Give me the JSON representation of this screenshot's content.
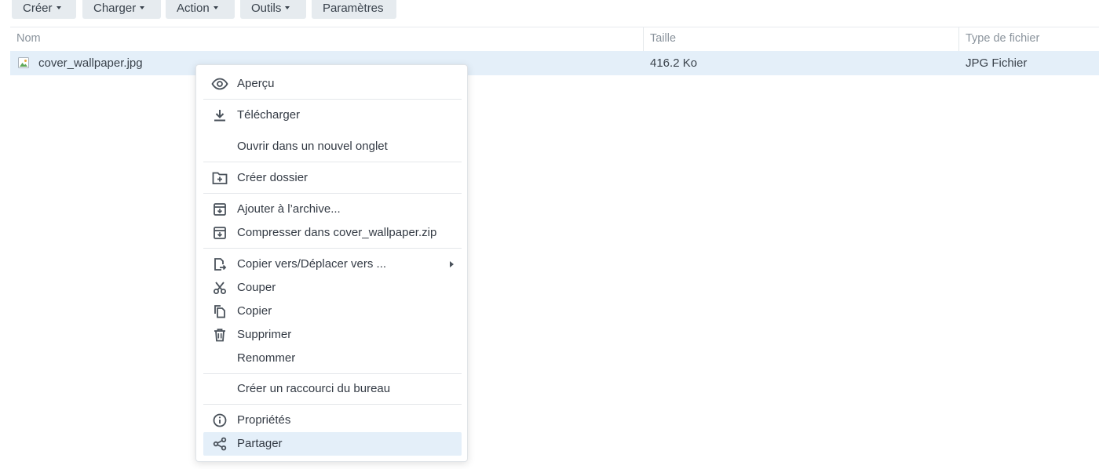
{
  "toolbar": {
    "create": "Créer",
    "upload": "Charger",
    "action": "Action",
    "tools": "Outils",
    "settings": "Paramètres"
  },
  "columns": {
    "name": "Nom",
    "size": "Taille",
    "type": "Type de fichier"
  },
  "file": {
    "name": "cover_wallpaper.jpg",
    "size": "416.2 Ko",
    "type": "JPG Fichier",
    "icon": "image-file-icon"
  },
  "context_menu": {
    "preview": "Aperçu",
    "download": "Télécharger",
    "open_new_tab": "Ouvrir dans un nouvel onglet",
    "create_folder": "Créer dossier",
    "add_to_archive": "Ajouter à l’archive...",
    "compress_to": "Compresser dans cover_wallpaper.zip",
    "copy_move_to": "Copier vers/Déplacer vers ...",
    "cut": "Couper",
    "copy": "Copier",
    "delete": "Supprimer",
    "rename": "Renommer",
    "desktop_shortcut": "Créer un raccourci du bureau",
    "properties": "Propriétés",
    "share": "Partager",
    "highlighted_item": "Partager"
  },
  "colors": {
    "selection": "#e4eff9",
    "toolbar_button": "#e6ebef",
    "text": "#333a44",
    "header_text": "#8a939c"
  }
}
